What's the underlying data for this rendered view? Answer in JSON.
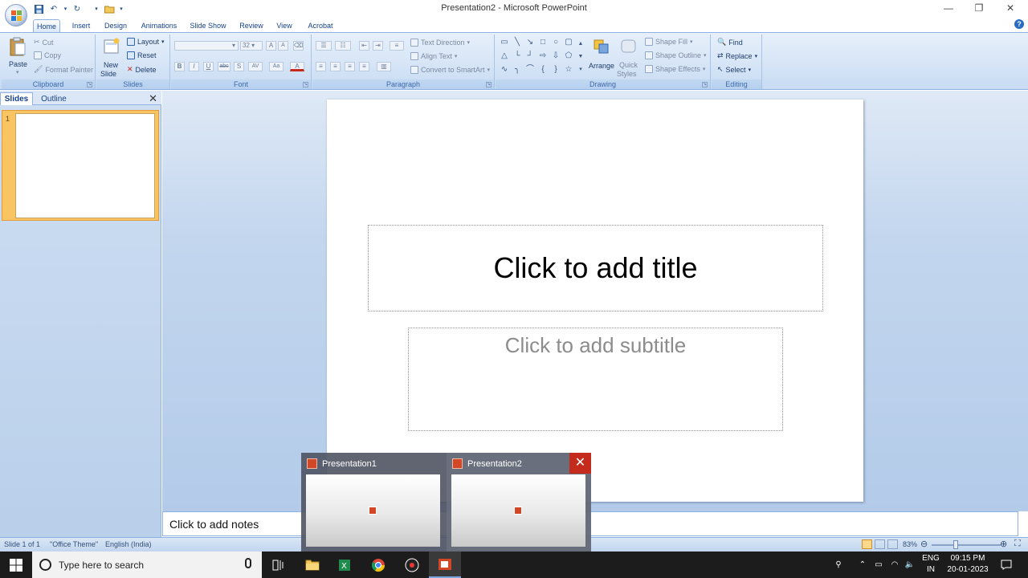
{
  "window": {
    "title": "Presentation2 - Microsoft PowerPoint",
    "minimize": "—",
    "restore": "❐",
    "close": "✕"
  },
  "colors": {
    "ribbon_bg": "#d5e4f6",
    "accent_blue": "#15428b",
    "thumb_selected": "#f9c563",
    "close_red": "#c42b1c",
    "taskbar": "#1c1c1c"
  },
  "tabs": [
    "Home",
    "Insert",
    "Design",
    "Animations",
    "Slide Show",
    "Review",
    "View",
    "Acrobat"
  ],
  "ribbon": {
    "clipboard": {
      "label": "Clipboard",
      "paste": "Paste",
      "cut": "Cut",
      "copy": "Copy",
      "format_painter": "Format Painter"
    },
    "slides": {
      "label": "Slides",
      "new_slide_1": "New",
      "new_slide_2": "Slide",
      "layout": "Layout",
      "reset": "Reset",
      "delete": "Delete"
    },
    "font": {
      "label": "Font",
      "font_name": "",
      "font_size": "32",
      "bold": "B",
      "italic": "I",
      "underline": "U",
      "strike": "abc",
      "shadow": "S",
      "spacing": "AV",
      "case": "Aa",
      "color": "A"
    },
    "paragraph": {
      "label": "Paragraph",
      "text_direction": "Text Direction",
      "align_text": "Align Text",
      "smartart": "Convert to SmartArt"
    },
    "drawing": {
      "label": "Drawing",
      "arrange": "Arrange",
      "quick_styles_1": "Quick",
      "quick_styles_2": "Styles",
      "shape_fill": "Shape Fill",
      "shape_outline": "Shape Outline",
      "shape_effects": "Shape Effects"
    },
    "editing": {
      "label": "Editing",
      "find": "Find",
      "replace": "Replace",
      "select": "Select"
    }
  },
  "pane": {
    "tab_slides": "Slides",
    "tab_outline": "Outline",
    "close": "✕",
    "slide_number": "1"
  },
  "slide": {
    "title_placeholder": "Click to add title",
    "subtitle_placeholder": "Click to add subtitle"
  },
  "notes": {
    "placeholder": "Click to add notes"
  },
  "status": {
    "slide_of": "Slide 1 of 1",
    "theme": "\"Office Theme\"",
    "language": "English (India)",
    "zoom": "83%",
    "zoom_level": 0.35
  },
  "preview": {
    "items": [
      {
        "title": "Presentation1"
      },
      {
        "title": "Presentation2"
      }
    ],
    "close": "✕"
  },
  "taskbar": {
    "search_placeholder": "Type here to search",
    "lang_1": "ENG",
    "lang_2": "IN",
    "time": "09:15 PM",
    "date": "20-01-2023"
  }
}
